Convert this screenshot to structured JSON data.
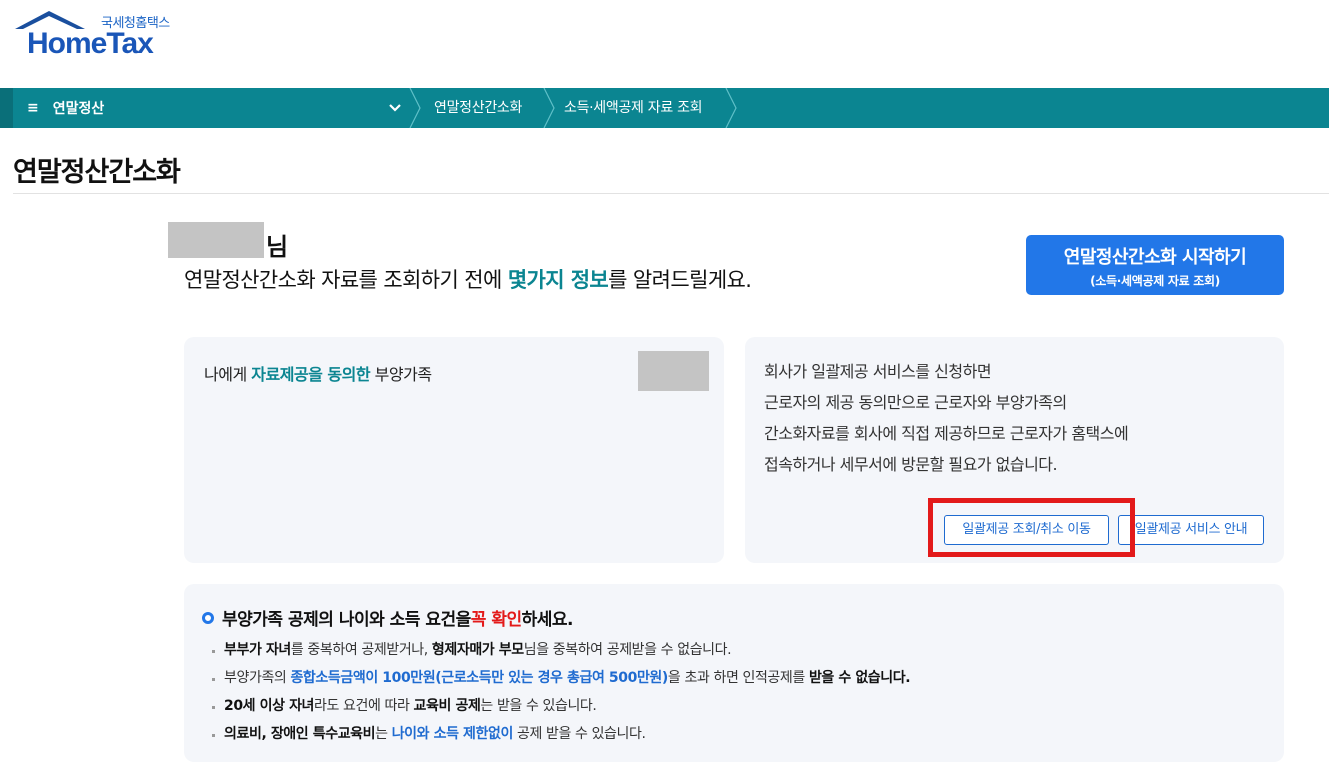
{
  "logo": {
    "kr": "국세청홈택스",
    "en": "HomeTax"
  },
  "nav": {
    "menu_icon": "≡",
    "menu_label": "연말정산",
    "crumbs": [
      "연말정산간소화",
      "소득·세액공제 자료 조회"
    ]
  },
  "page_title": "연말정산간소화",
  "greeting": {
    "suffix": "님",
    "intro_before": "연말정산간소화 자료를 조회하기 전에 ",
    "intro_highlight": "몇가지 정보",
    "intro_after": "를 알려드릴게요."
  },
  "start_button": {
    "line1": "연말정산간소화 시작하기",
    "line2": "(소득·세액공제 자료 조회)"
  },
  "card_left": {
    "before": "나에게 ",
    "highlight": "자료제공을 동의한",
    "after": " 부양가족"
  },
  "card_right": {
    "lines": [
      "회사가 일괄제공 서비스를 신청하면",
      "근로자의 제공 동의만으로 근로자와 부양가족의",
      "간소화자료를 회사에 직접 제공하므로 근로자가 홈택스에",
      "접속하거나 세무서에 방문할 필요가 없습니다."
    ],
    "btn_consent": "일괄제공 조회/취소 이동",
    "btn_guide": "일괄제공 서비스 안내"
  },
  "notice": {
    "head_before": "부양가족 공제의 나이와 소득 요건을 ",
    "head_red": "꼭 확인",
    "head_after": "하세요.",
    "items": [
      {
        "p1": "부부가 자녀",
        "p2": "를 중복하여 공제받거나, ",
        "p3": "형제자매가 부모",
        "p4": "님을 중복하여 공제받을 수 없습니다."
      },
      {
        "p1": "부양가족의 ",
        "p2": "종합소득금액이 100만원(근로소득만 있는 경우 총급여 500만원)",
        "p3": "을 초과 하면 인적공제를 ",
        "p4": "받을 수 없습니다."
      },
      {
        "p1": "20세 이상 자녀",
        "p2": "라도 요건에 따라 ",
        "p3": "교육비 공제",
        "p4": "는 받을 수 있습니다."
      },
      {
        "p1": "의료비, 장애인 특수교육비",
        "p2": "는 ",
        "p3": "나이와 소득 제한없이",
        "p4": " 공제 받을 수 있습니다."
      }
    ]
  },
  "colors": {
    "teal": "#0b8591",
    "blue": "#2277e8",
    "red": "#e31a1a"
  }
}
